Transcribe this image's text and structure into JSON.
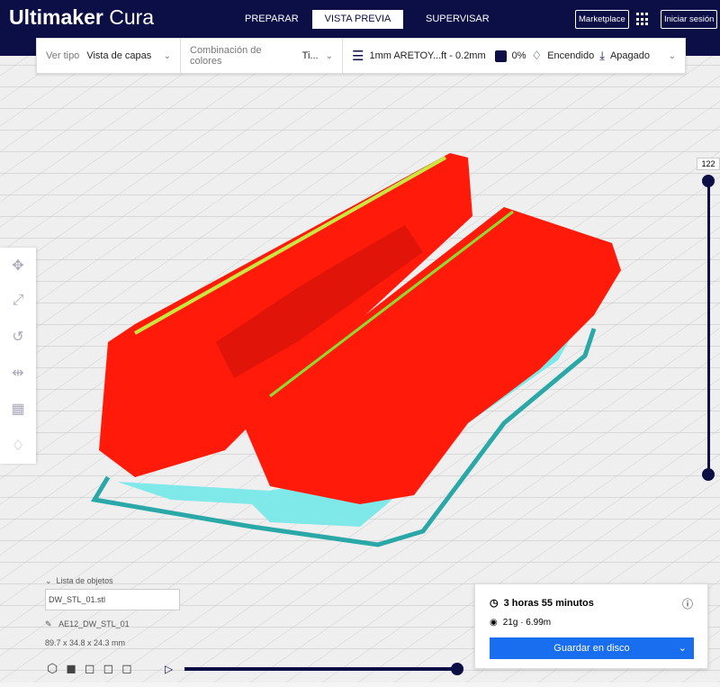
{
  "header": {
    "logo_bold": "Ultimaker",
    "logo_light": "Cura",
    "tabs": [
      "PREPARAR",
      "VISTA PREVIA",
      "SUPERVISAR"
    ],
    "marketplace": "Marketplace",
    "login": "Iniciar sesión"
  },
  "toolbar": {
    "view_type_label": "Ver tipo",
    "view_type_value": "Vista de capas",
    "color_label": "Combinación de colores",
    "color_value": "Ti...",
    "profile": "1mm ARETOY...ft - 0.2mm",
    "infill": "0%",
    "support": "Encendido",
    "adhesion": "Apagado"
  },
  "layer_slider": {
    "value": "122"
  },
  "objects": {
    "title": "Lista de objetos",
    "file": "DW_STL_01.stl",
    "name": "AE12_DW_STL_01",
    "dimensions": "89.7 x 34.8 x 24.3 mm"
  },
  "print": {
    "time": "3 horas 55 minutos",
    "material": "21g · 6.99m",
    "save": "Guardar en disco"
  },
  "colors": {
    "header": "#0b0f45",
    "model": "#ff1a0a",
    "support": "#7fe8e8",
    "accent": "#196ef0"
  }
}
